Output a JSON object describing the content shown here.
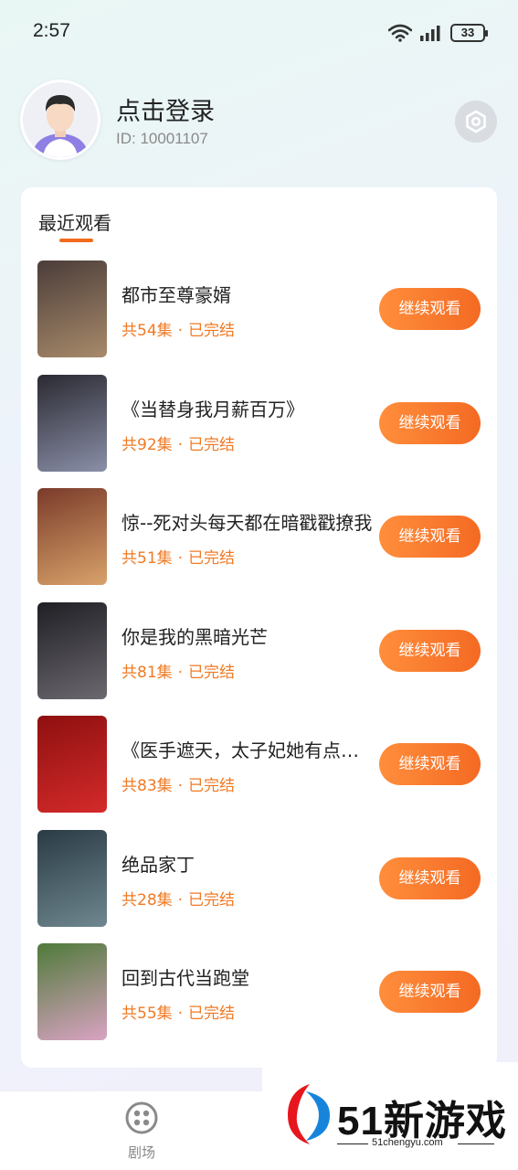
{
  "status_bar": {
    "time": "2:57",
    "battery": "33"
  },
  "profile": {
    "title": "点击登录",
    "user_id": "ID: 10001107"
  },
  "recent": {
    "title": "最近观看",
    "items": [
      {
        "title": "都市至尊豪婿",
        "episodes": "共54集",
        "status": "已完结",
        "button": "继续观看",
        "cover_colors": [
          "#4b3d3a",
          "#a88a6a"
        ]
      },
      {
        "title": "《当替身我月薪百万》",
        "episodes": "共92集",
        "status": "已完结",
        "button": "继续观看",
        "cover_colors": [
          "#2b2a32",
          "#8a8fa8"
        ]
      },
      {
        "title": "惊--死对头每天都在暗戳戳撩我",
        "episodes": "共51集",
        "status": "已完结",
        "button": "继续观看",
        "cover_colors": [
          "#7a3b2a",
          "#d8a26a"
        ]
      },
      {
        "title": "你是我的黑暗光芒",
        "episodes": "共81集",
        "status": "已完结",
        "button": "继续观看",
        "cover_colors": [
          "#1f1f24",
          "#6c6870"
        ]
      },
      {
        "title": "《医手遮天，太子妃她有点飒》",
        "episodes": "共83集",
        "status": "已完结",
        "button": "继续观看",
        "cover_colors": [
          "#8e1010",
          "#d42a2a"
        ]
      },
      {
        "title": "绝品家丁",
        "episodes": "共28集",
        "status": "已完结",
        "button": "继续观看",
        "cover_colors": [
          "#2a3b44",
          "#6f8790"
        ]
      },
      {
        "title": "回到古代当跑堂",
        "episodes": "共55集",
        "status": "已完结",
        "button": "继续观看",
        "cover_colors": [
          "#4f7a3a",
          "#d9a3c2"
        ]
      }
    ]
  },
  "bottom_nav": {
    "tab_label": "剧场",
    "icon": "theater-icon"
  },
  "watermark": {
    "text": "51新游戏",
    "sub": "51chengyu.com"
  }
}
